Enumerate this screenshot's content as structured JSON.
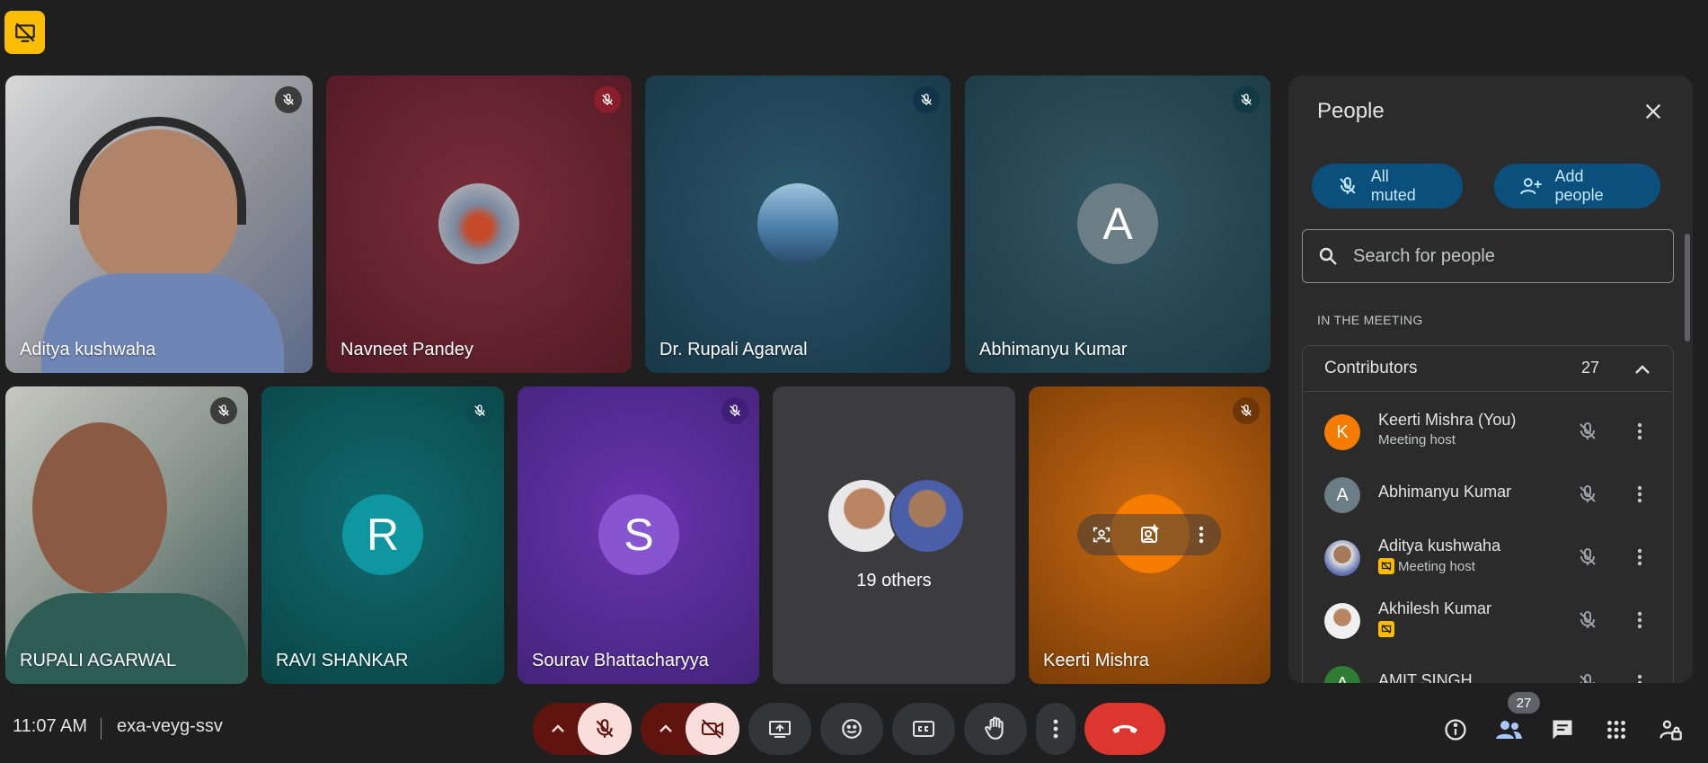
{
  "topbar": {
    "badge_icon": "presentation-off-icon"
  },
  "tiles": [
    {
      "name": "Aditya kushwaha"
    },
    {
      "name": "Navneet Pandey"
    },
    {
      "name": "Dr. Rupali Agarwal"
    },
    {
      "name": "Abhimanyu Kumar",
      "initial": "A"
    },
    {
      "name": "RUPALI AGARWAL"
    },
    {
      "name": "RAVI SHANKAR",
      "initial": "R"
    },
    {
      "name": "Sourav Bhattacharyya",
      "initial": "S"
    },
    {
      "name": "19 others"
    },
    {
      "name": "Keerti Mishra"
    }
  ],
  "people_panel": {
    "title": "People",
    "all_muted_label": "All muted",
    "add_people_label": "Add people",
    "search_placeholder": "Search for people",
    "section_label": "IN THE MEETING",
    "group": {
      "label": "Contributors",
      "count": "27"
    },
    "people": [
      {
        "initial": "K",
        "name": "Keerti Mishra (You)",
        "sub": "Meeting host"
      },
      {
        "initial": "A",
        "name": "Abhimanyu Kumar",
        "sub": ""
      },
      {
        "initial": "",
        "name": "Aditya kushwaha",
        "sub": "Meeting host"
      },
      {
        "initial": "",
        "name": "Akhilesh Kumar",
        "sub": ""
      },
      {
        "initial": "A",
        "name": "AMIT SINGH",
        "sub": ""
      }
    ]
  },
  "bottom_bar": {
    "time": "11:07 AM",
    "meeting_code": "exa-veyg-ssv",
    "people_count": "27"
  },
  "colors": {
    "background": "#1f1f1f",
    "panel": "#2b2b2b",
    "end_call": "#dc362e",
    "accent_pill": "#0b4f7d",
    "host_badge": "#fbbc04"
  }
}
